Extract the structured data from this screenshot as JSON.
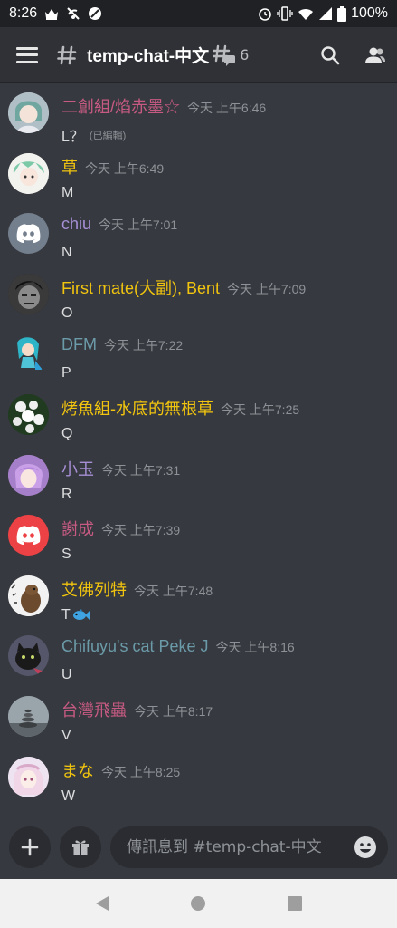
{
  "status_bar": {
    "time": "8:26",
    "battery": "100%",
    "icons": [
      "crown-icon",
      "signal-off-icon",
      "block-icon",
      "alarm-icon",
      "vibrate-icon",
      "wifi-icon",
      "cellular-icon",
      "battery-icon"
    ]
  },
  "header": {
    "channel_name": "temp-chat-中文",
    "thread_count": "6",
    "icons": [
      "menu-icon",
      "channel-hash-icon",
      "threads-icon",
      "search-icon",
      "members-icon"
    ]
  },
  "messages": [
    {
      "author": "二創組/焰赤墨☆",
      "author_color": "#c75a82",
      "time": "今天 上午6:46",
      "text": "L？",
      "edited": "(已編輯)"
    },
    {
      "author": "草",
      "author_color": "#f1c40f",
      "time": "今天 上午6:49",
      "text": "M",
      "edited": ""
    },
    {
      "author": "chiu",
      "author_color": "#a78fd6",
      "time": "今天 上午7:01",
      "text": "N",
      "edited": ""
    },
    {
      "author": "First mate(大副), Bent",
      "author_color": "#f1c40f",
      "time": "今天 上午7:09",
      "text": "O",
      "edited": ""
    },
    {
      "author": "DFM",
      "author_color": "#6b9aa8",
      "time": "今天 上午7:22",
      "text": "P",
      "edited": ""
    },
    {
      "author": "烤魚組-水底的無根草",
      "author_color": "#f1c40f",
      "time": "今天 上午7:25",
      "text": "Q",
      "edited": ""
    },
    {
      "author": "小玉",
      "author_color": "#a78fd6",
      "time": "今天 上午7:31",
      "text": "R",
      "edited": ""
    },
    {
      "author": "謝成",
      "author_color": "#c75a82",
      "time": "今天 上午7:39",
      "text": "S",
      "edited": ""
    },
    {
      "author": "艾佛列特",
      "author_color": "#f1c40f",
      "time": "今天 上午7:48",
      "text": "T",
      "edited": ""
    },
    {
      "author": "Chifuyu's cat Peke J",
      "author_color": "#6b9aa8",
      "time": "今天 上午8:16",
      "text": "U",
      "edited": ""
    },
    {
      "author": "台灣飛蟲",
      "author_color": "#c75a82",
      "time": "今天 上午8:17",
      "text": "V",
      "edited": ""
    },
    {
      "author": "まな",
      "author_color": "#f1c40f",
      "time": "今天 上午8:25",
      "text": "W",
      "edited": ""
    }
  ],
  "composer": {
    "placeholder": "傳訊息到 #temp-chat-中文",
    "icons": [
      "plus-icon",
      "gift-icon",
      "emoji-icon"
    ]
  },
  "nav_bar": {
    "icons": [
      "back-icon",
      "home-icon",
      "recents-icon"
    ]
  },
  "colors": {
    "background": "#36393f",
    "header": "#2f3136",
    "discord_blurple": "#5865f2",
    "discord_red": "#ed4245"
  }
}
